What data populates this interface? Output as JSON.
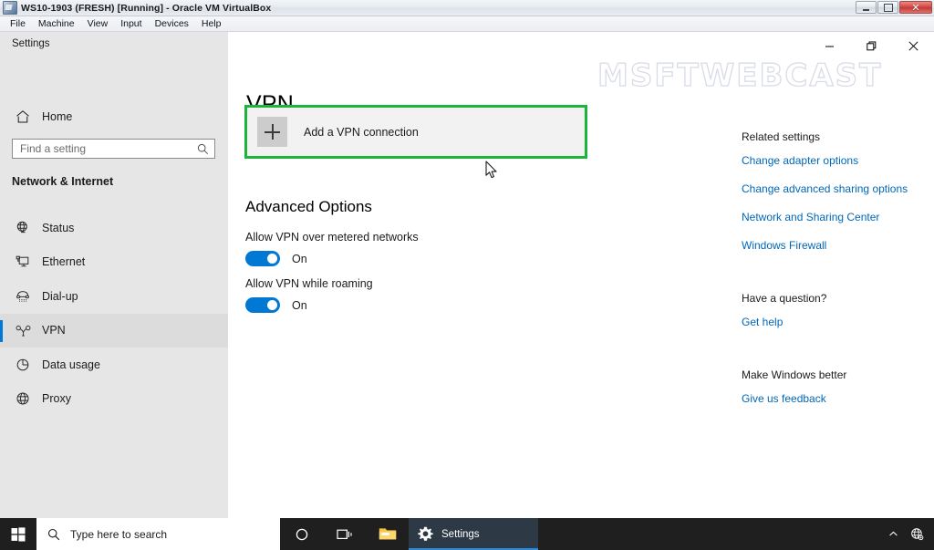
{
  "vbox": {
    "title": "WS10-1903 (FRESH) [Running] - Oracle VM VirtualBox",
    "app_icon": "virtualbox-icon",
    "menus": [
      "File",
      "Machine",
      "View",
      "Input",
      "Devices",
      "Help"
    ],
    "window_controls": {
      "minimize": "minimize-icon",
      "maximize": "maximize-icon",
      "close": "✕"
    }
  },
  "settings": {
    "nav": {
      "header": "Settings",
      "home_label": "Home",
      "search_placeholder": "Find a setting",
      "search_value": "",
      "section_title": "Network & Internet",
      "items": [
        {
          "label": "Status",
          "icon": "status-globe-icon",
          "selected": false
        },
        {
          "label": "Ethernet",
          "icon": "ethernet-icon",
          "selected": false
        },
        {
          "label": "Dial-up",
          "icon": "dialup-phone-icon",
          "selected": false
        },
        {
          "label": "VPN",
          "icon": "vpn-icon",
          "selected": true
        },
        {
          "label": "Data usage",
          "icon": "pie-chart-icon",
          "selected": false
        },
        {
          "label": "Proxy",
          "icon": "globe-icon",
          "selected": false
        }
      ]
    },
    "window_controls": {
      "minimize": "minimize-icon",
      "restore": "restore-icon",
      "close": "close-icon"
    },
    "watermark": "MSFTWEBCAST",
    "main": {
      "title": "VPN",
      "add_connection_label": "Add a VPN connection",
      "add_connection_icon": "plus-icon",
      "highlight_color": "#1bb53c",
      "advanced_heading": "Advanced Options",
      "toggles": [
        {
          "caption": "Allow VPN over metered networks",
          "state": "On",
          "on": true
        },
        {
          "caption": "Allow VPN while roaming",
          "state": "On",
          "on": true
        }
      ]
    },
    "related": {
      "heading": "Related settings",
      "links": [
        "Change adapter options",
        "Change advanced sharing options",
        "Network and Sharing Center",
        "Windows Firewall"
      ],
      "question_heading": "Have a question?",
      "question_link": "Get help",
      "feedback_heading": "Make Windows better",
      "feedback_link": "Give us feedback"
    },
    "accent_color": "#0078d7"
  },
  "taskbar": {
    "start_icon": "windows-start-icon",
    "search_placeholder": "Type here to search",
    "search_icon": "search-icon",
    "cortana_icon": "cortana-circle-icon",
    "taskview_icon": "task-view-icon",
    "explorer_icon": "file-explorer-icon",
    "app_label": "Settings",
    "app_icon": "gear-icon",
    "tray": {
      "chevron": "chevron-up-icon",
      "network": "network-globe-icon"
    }
  }
}
